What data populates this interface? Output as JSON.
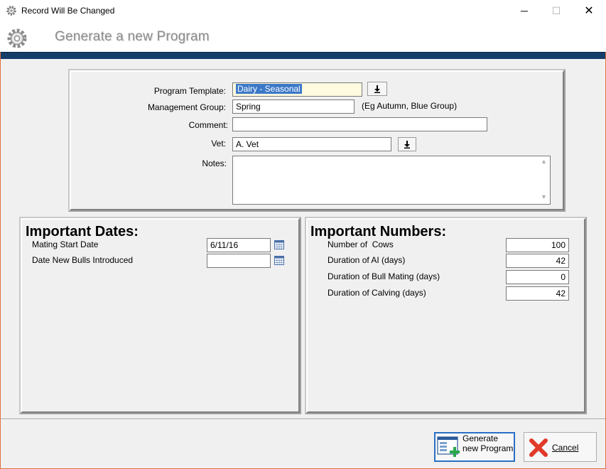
{
  "window": {
    "title": "Record Will Be Changed",
    "minimize": "─",
    "maximize": "☐",
    "close": "✕"
  },
  "header": {
    "title": "Generate a new Program"
  },
  "form": {
    "program_template_label": "Program Template:",
    "program_template_value": "Dairy - Seasonal",
    "management_group_label": "Management Group:",
    "management_group_value": "Spring",
    "management_group_hint": "(Eg Autumn, Blue Group)",
    "comment_label": "Comment:",
    "comment_value": "",
    "vet_label": "Vet:",
    "vet_value": "A. Vet",
    "notes_label": "Notes:",
    "notes_value": ""
  },
  "dates": {
    "title": "Important Dates:",
    "mating_start_label": "Mating Start Date",
    "mating_start_value": "6/11/16",
    "bulls_introduced_label": "Date New Bulls Introduced",
    "bulls_introduced_value": ""
  },
  "numbers": {
    "title": "Important Numbers:",
    "rows": [
      {
        "label": "Number of  Cows",
        "value": "100"
      },
      {
        "label": "Duration of AI (days)",
        "value": "42"
      },
      {
        "label": "Duration of Bull Mating (days)",
        "value": "0"
      },
      {
        "label": "Duration of Calving (days)",
        "value": "42"
      }
    ]
  },
  "buttons": {
    "generate_label": "Generate new Program",
    "cancel_label": "Cancel"
  }
}
